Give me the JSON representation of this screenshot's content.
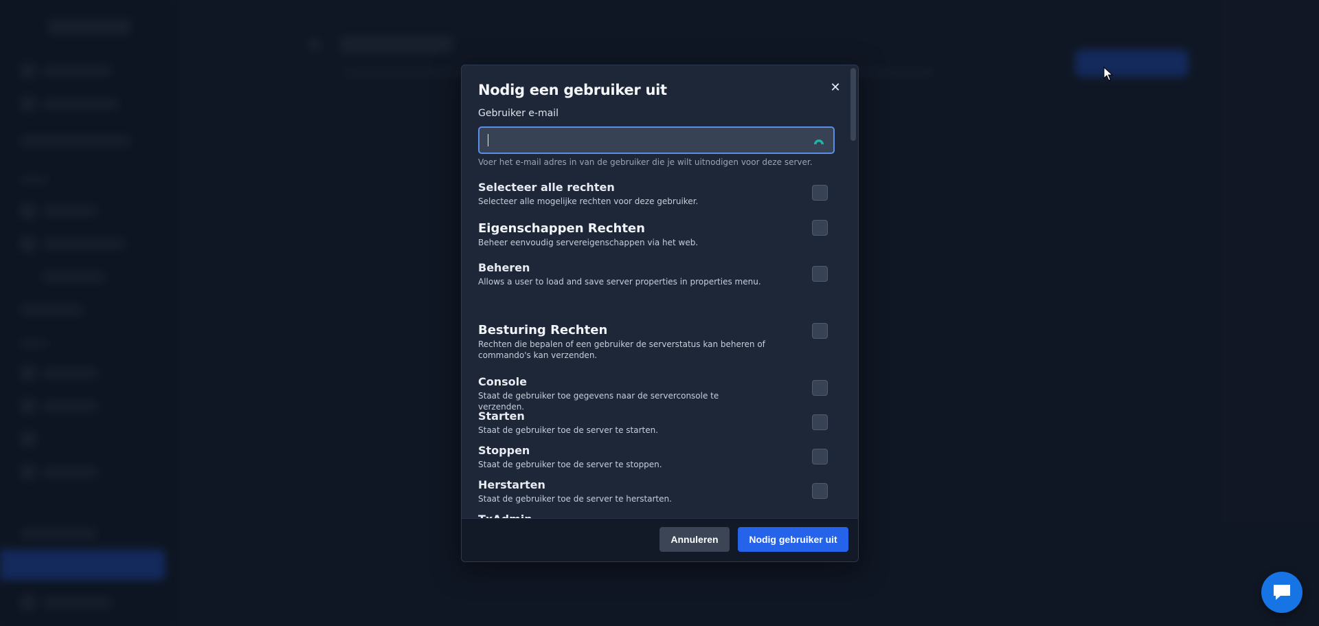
{
  "modal": {
    "title": "Nodig een gebruiker uit",
    "email": {
      "label": "Gebruiker e-mail",
      "value": "",
      "help": "Voer het e-mail adres in van de gebruiker die je wilt uitnodigen voor deze server."
    },
    "permissions": [
      {
        "name": "Selecteer alle rechten",
        "desc": "Selecteer alle mogelijke rechten voor deze gebruiker.",
        "checked": false
      },
      {
        "name": "Eigenschappen Rechten",
        "desc": "Beheer eenvoudig servereigenschappen via het web.",
        "checked": false
      },
      {
        "name": "Beheren",
        "desc": "Allows a user to load and save server properties in properties menu.",
        "checked": false
      },
      {
        "name": "Besturing Rechten",
        "desc": "Rechten die bepalen of een gebruiker de serverstatus kan beheren of commando's kan verzenden.",
        "checked": false
      },
      {
        "name": "Console",
        "desc": "Staat de gebruiker toe gegevens naar de serverconsole te verzenden.",
        "checked": false
      },
      {
        "name": "Starten",
        "desc": "Staat de gebruiker toe de server te starten.",
        "checked": false
      },
      {
        "name": "Stoppen",
        "desc": "Staat de gebruiker toe de server te stoppen.",
        "checked": false
      },
      {
        "name": "Herstarten",
        "desc": "Staat de gebruiker toe de server te herstarten.",
        "checked": false
      },
      {
        "name": "TxAdmin",
        "desc": "",
        "checked": false
      }
    ],
    "buttons": {
      "cancel": "Annuleren",
      "invite": "Nodig gebruiker uit"
    },
    "close_icon": "close-icon"
  },
  "colors": {
    "primary": "#2563eb",
    "modal_bg": "#1e2738",
    "footer_bg": "#121a28",
    "chat_fab": "#1674e5"
  }
}
